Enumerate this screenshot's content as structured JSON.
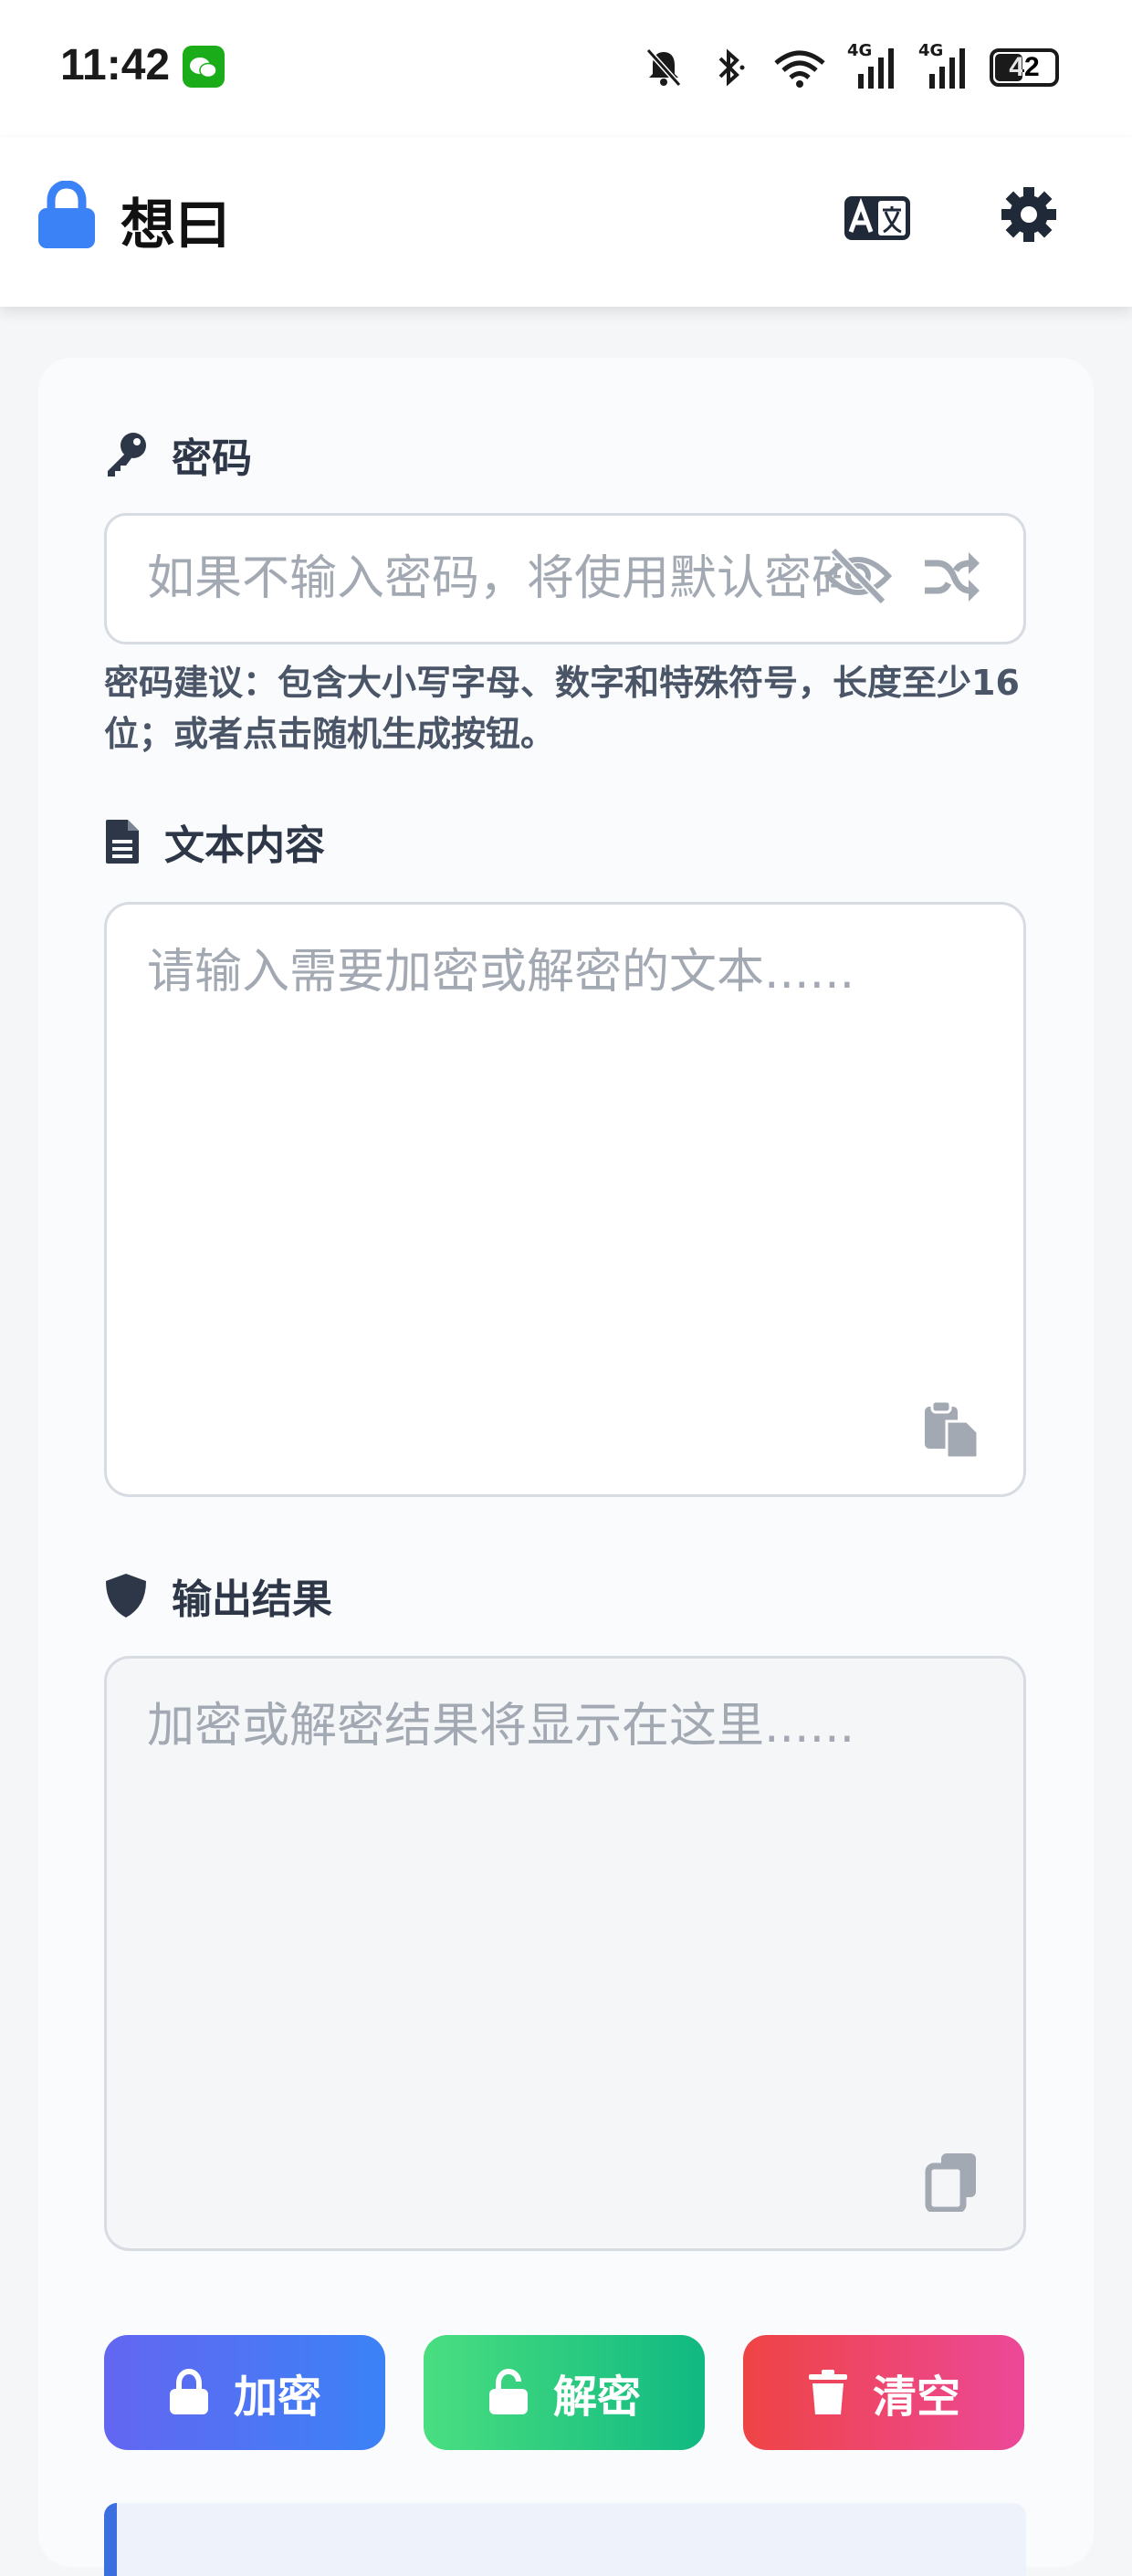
{
  "status_bar": {
    "time": "11:42",
    "battery": "42",
    "network_1": "4G",
    "network_2": "4G",
    "icons": [
      "wechat-icon",
      "bell-mute-icon",
      "bluetooth-icon",
      "wifi-icon",
      "signal-icon",
      "signal-icon",
      "battery-icon"
    ]
  },
  "app_bar": {
    "title": "想曰",
    "icons": [
      "lock-icon",
      "translate-icon",
      "gear-icon"
    ],
    "accent": "#3b82f6"
  },
  "password": {
    "label": "密码",
    "placeholder": "如果不输入密码，将使用默认密码",
    "value": "",
    "hint": "密码建议：包含大小写字母、数字和特殊符号，长度至少16位；或者点击随机生成按钮。",
    "icons": [
      "key-icon",
      "eye-slash-icon",
      "shuffle-icon"
    ]
  },
  "text_content": {
    "label": "文本内容",
    "placeholder": "请输入需要加密或解密的文本......",
    "value": "",
    "icons": [
      "document-icon",
      "paste-icon"
    ]
  },
  "output": {
    "label": "输出结果",
    "placeholder": "加密或解密结果将显示在这里......",
    "value": "",
    "icons": [
      "shield-icon",
      "copy-icon"
    ]
  },
  "actions": {
    "encrypt_label": "加密",
    "decrypt_label": "解密",
    "clear_label": "清空",
    "colors": {
      "encrypt": [
        "#6366f1",
        "#3b82f6"
      ],
      "decrypt": [
        "#4ade80",
        "#10b981"
      ],
      "clear": [
        "#ef4444",
        "#ec4899"
      ]
    }
  }
}
